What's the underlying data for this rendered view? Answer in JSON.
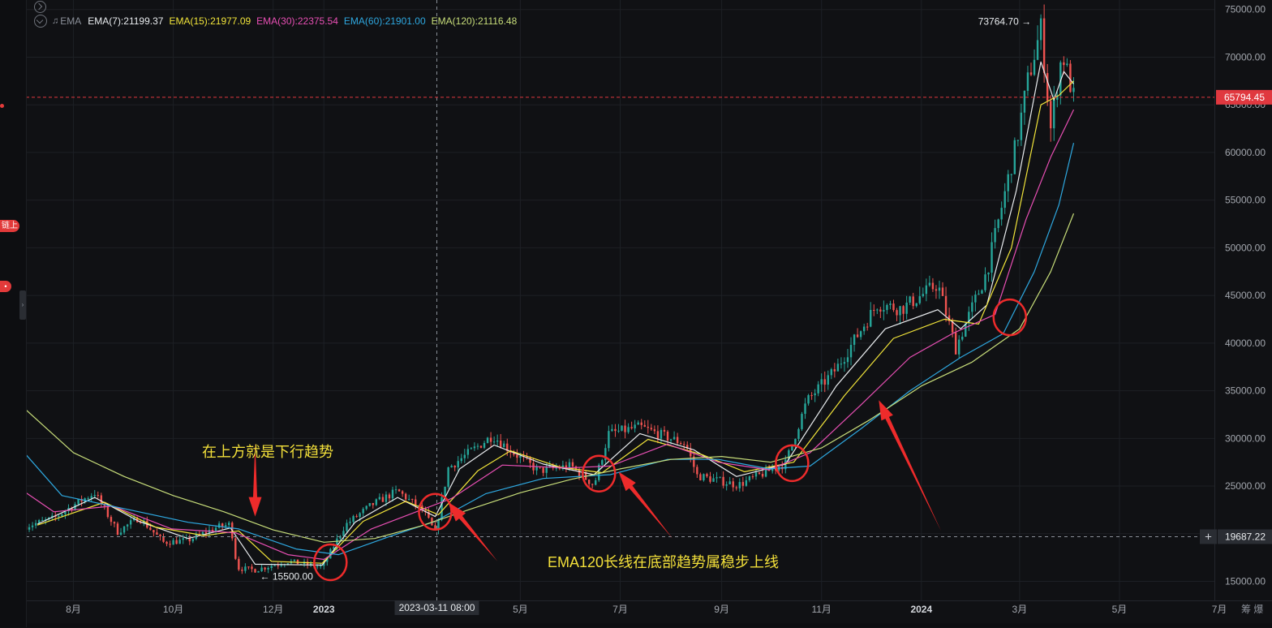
{
  "legend": {
    "indicator": "EMA",
    "items": [
      {
        "label": "EMA(7):21199.37",
        "color": "#e9ecef"
      },
      {
        "label": "EMA(15):21977.09",
        "color": "#f2e53a"
      },
      {
        "label": "EMA(30):22375.54",
        "color": "#e84fb4"
      },
      {
        "label": "EMA(60):21901.00",
        "color": "#2ea8e0"
      },
      {
        "label": "EMA(120):21116.48",
        "color": "#c8de7a"
      }
    ]
  },
  "left_rail": {
    "badge": "链上",
    "dot": "•"
  },
  "annotations": {
    "top_text": "在上方就是下行趋势",
    "bottom_text": "EMA120长线在底部趋势属稳步上线",
    "high_label": "73764.70",
    "low_label": "15500.00"
  },
  "markers": {
    "current_price": "65794.45",
    "crosshair_price": "19687.22",
    "crosshair_time": "2023-03-11 08:00"
  },
  "corner_label": "筹 爆",
  "colors": {
    "up": "#26a69a",
    "down": "#ef5350",
    "grid": "#1d2025",
    "annotation": "#f3e03a",
    "arrow": "#ee2b2b",
    "price_tag": "#e0383f"
  },
  "chart_data": {
    "type": "line",
    "title": "",
    "xlabel": "",
    "ylabel": "",
    "ylim": [
      13000,
      76000
    ],
    "y_ticks": [
      15000,
      20000,
      25000,
      30000,
      35000,
      40000,
      45000,
      50000,
      55000,
      60000,
      65000,
      70000,
      75000
    ],
    "y_tick_labels": [
      "15000.00",
      "20000.00",
      "25000.00",
      "30000.00",
      "35000.00",
      "40000.00",
      "45000.00",
      "50000.00",
      "55000.00",
      "60000.00",
      "65000.00",
      "70000.00",
      "75000.00"
    ],
    "xlim": [
      "2022-07-03",
      "2024-06-28"
    ],
    "x_ticks": [
      {
        "date": "2022-08-01",
        "label": "8月"
      },
      {
        "date": "2022-10-01",
        "label": "10月"
      },
      {
        "date": "2022-12-01",
        "label": "12月"
      },
      {
        "date": "2023-01-01",
        "label": "2023"
      },
      {
        "date": "2023-05-01",
        "label": "5月"
      },
      {
        "date": "2023-07-01",
        "label": "7月"
      },
      {
        "date": "2023-09-01",
        "label": "9月"
      },
      {
        "date": "2023-11-01",
        "label": "11月"
      },
      {
        "date": "2024-01-01",
        "label": "2024"
      },
      {
        "date": "2024-03-01",
        "label": "3月"
      },
      {
        "date": "2024-05-01",
        "label": "5月"
      },
      {
        "date": "2024-07-01",
        "label": "7月"
      }
    ],
    "price_path": [
      [
        "2022-07-03",
        20800
      ],
      [
        "2022-07-20",
        21600
      ],
      [
        "2022-08-01",
        23000
      ],
      [
        "2022-08-14",
        24300
      ],
      [
        "2022-08-28",
        20200
      ],
      [
        "2022-09-10",
        21700
      ],
      [
        "2022-09-25",
        19100
      ],
      [
        "2022-10-10",
        19300
      ],
      [
        "2022-10-28",
        20700
      ],
      [
        "2022-11-05",
        21000
      ],
      [
        "2022-11-09",
        16400
      ],
      [
        "2022-11-20",
        16200
      ],
      [
        "2022-12-10",
        17100
      ],
      [
        "2022-12-31",
        16500
      ],
      [
        "2023-01-14",
        20900
      ],
      [
        "2023-01-30",
        23000
      ],
      [
        "2023-02-15",
        24500
      ],
      [
        "2023-03-03",
        22300
      ],
      [
        "2023-03-10",
        20100
      ],
      [
        "2023-03-18",
        26900
      ],
      [
        "2023-04-14",
        30300
      ],
      [
        "2023-04-26",
        28600
      ],
      [
        "2023-05-12",
        26600
      ],
      [
        "2023-06-01",
        27100
      ],
      [
        "2023-06-15",
        25100
      ],
      [
        "2023-06-24",
        30500
      ],
      [
        "2023-07-13",
        31200
      ],
      [
        "2023-08-10",
        29400
      ],
      [
        "2023-08-17",
        26100
      ],
      [
        "2023-09-11",
        25100
      ],
      [
        "2023-10-10",
        27400
      ],
      [
        "2023-10-23",
        33900
      ],
      [
        "2023-11-10",
        37300
      ],
      [
        "2023-12-05",
        44100
      ],
      [
        "2023-12-20",
        43600
      ],
      [
        "2024-01-11",
        46200
      ],
      [
        "2024-01-22",
        39500
      ],
      [
        "2024-02-10",
        47500
      ],
      [
        "2024-02-28",
        61000
      ],
      [
        "2024-03-06",
        67500
      ],
      [
        "2024-03-14",
        73000
      ],
      [
        "2024-03-20",
        62500
      ],
      [
        "2024-03-27",
        70500
      ],
      [
        "2024-04-03",
        65794
      ]
    ],
    "high": {
      "date": "2024-03-14",
      "value": 73764.7
    },
    "low": {
      "date": "2022-11-21",
      "value": 15500.0
    },
    "current_price": 65794.45,
    "crosshair": {
      "date": "2023-03-11",
      "value": 19687.22
    },
    "series": [
      {
        "name": "EMA(7)",
        "color": "#e9ecef",
        "points": [
          [
            "2022-07-10",
            21000
          ],
          [
            "2022-08-14",
            23800
          ],
          [
            "2022-09-10",
            21300
          ],
          [
            "2022-10-10",
            19500
          ],
          [
            "2022-11-05",
            20600
          ],
          [
            "2022-11-20",
            16800
          ],
          [
            "2022-12-31",
            16700
          ],
          [
            "2023-01-20",
            21200
          ],
          [
            "2023-02-15",
            23800
          ],
          [
            "2023-03-10",
            21800
          ],
          [
            "2023-03-25",
            26800
          ],
          [
            "2023-04-15",
            29300
          ],
          [
            "2023-05-15",
            27300
          ],
          [
            "2023-06-15",
            26200
          ],
          [
            "2023-07-13",
            30500
          ],
          [
            "2023-08-15",
            28800
          ],
          [
            "2023-09-10",
            26000
          ],
          [
            "2023-10-10",
            27300
          ],
          [
            "2023-11-10",
            35500
          ],
          [
            "2023-12-10",
            41500
          ],
          [
            "2024-01-11",
            43500
          ],
          [
            "2024-01-25",
            41500
          ],
          [
            "2024-02-10",
            44000
          ],
          [
            "2024-02-28",
            56000
          ],
          [
            "2024-03-14",
            69500
          ],
          [
            "2024-03-22",
            65500
          ],
          [
            "2024-03-28",
            68500
          ],
          [
            "2024-04-03",
            67200
          ]
        ]
      },
      {
        "name": "EMA(15)",
        "color": "#f2e53a",
        "points": [
          [
            "2022-07-10",
            20900
          ],
          [
            "2022-08-20",
            23300
          ],
          [
            "2022-09-20",
            20700
          ],
          [
            "2022-10-20",
            19800
          ],
          [
            "2022-11-10",
            20300
          ],
          [
            "2022-11-30",
            17100
          ],
          [
            "2022-12-31",
            16900
          ],
          [
            "2023-01-25",
            21300
          ],
          [
            "2023-02-20",
            23400
          ],
          [
            "2023-03-12",
            22000
          ],
          [
            "2023-04-05",
            26600
          ],
          [
            "2023-04-25",
            28700
          ],
          [
            "2023-05-25",
            27000
          ],
          [
            "2023-06-20",
            26400
          ],
          [
            "2023-07-18",
            29900
          ],
          [
            "2023-08-20",
            28300
          ],
          [
            "2023-09-15",
            26500
          ],
          [
            "2023-10-15",
            27500
          ],
          [
            "2023-11-15",
            34500
          ],
          [
            "2023-12-15",
            40500
          ],
          [
            "2024-01-15",
            42500
          ],
          [
            "2024-02-05",
            42000
          ],
          [
            "2024-02-25",
            50000
          ],
          [
            "2024-03-14",
            65000
          ],
          [
            "2024-03-25",
            66000
          ],
          [
            "2024-04-03",
            67500
          ]
        ]
      },
      {
        "name": "EMA(30)",
        "color": "#e84fb4",
        "points": [
          [
            "2022-07-03",
            24300
          ],
          [
            "2022-07-20",
            22300
          ],
          [
            "2022-08-25",
            22900
          ],
          [
            "2022-09-30",
            20500
          ],
          [
            "2022-11-08",
            20100
          ],
          [
            "2022-12-10",
            17800
          ],
          [
            "2023-01-01",
            17300
          ],
          [
            "2023-01-30",
            20500
          ],
          [
            "2023-02-28",
            22400
          ],
          [
            "2023-03-20",
            23700
          ],
          [
            "2023-04-20",
            27200
          ],
          [
            "2023-05-30",
            26900
          ],
          [
            "2023-06-25",
            27100
          ],
          [
            "2023-07-30",
            29400
          ],
          [
            "2023-08-30",
            27500
          ],
          [
            "2023-09-30",
            26700
          ],
          [
            "2023-10-25",
            28500
          ],
          [
            "2023-11-25",
            33500
          ],
          [
            "2023-12-25",
            38500
          ],
          [
            "2024-01-20",
            41000
          ],
          [
            "2024-02-15",
            43000
          ],
          [
            "2024-03-05",
            53000
          ],
          [
            "2024-03-20",
            59500
          ],
          [
            "2024-04-03",
            64500
          ]
        ]
      },
      {
        "name": "EMA(60)",
        "color": "#2ea8e0",
        "points": [
          [
            "2022-07-03",
            28300
          ],
          [
            "2022-07-25",
            24000
          ],
          [
            "2022-08-30",
            22700
          ],
          [
            "2022-10-10",
            21200
          ],
          [
            "2022-11-10",
            20500
          ],
          [
            "2022-12-15",
            18400
          ],
          [
            "2023-01-10",
            17800
          ],
          [
            "2023-02-10",
            19700
          ],
          [
            "2023-03-10",
            21300
          ],
          [
            "2023-04-10",
            24200
          ],
          [
            "2023-05-15",
            25800
          ],
          [
            "2023-06-25",
            26200
          ],
          [
            "2023-07-30",
            27800
          ],
          [
            "2023-08-30",
            27800
          ],
          [
            "2023-09-30",
            26800
          ],
          [
            "2023-10-25",
            27100
          ],
          [
            "2023-11-25",
            31000
          ],
          [
            "2023-12-25",
            35000
          ],
          [
            "2024-01-25",
            38500
          ],
          [
            "2024-02-20",
            41000
          ],
          [
            "2024-03-10",
            47500
          ],
          [
            "2024-03-25",
            54500
          ],
          [
            "2024-04-03",
            61000
          ]
        ]
      },
      {
        "name": "EMA(120)",
        "color": "#c8de7a",
        "points": [
          [
            "2022-07-03",
            33000
          ],
          [
            "2022-08-01",
            28500
          ],
          [
            "2022-09-01",
            26000
          ],
          [
            "2022-10-01",
            24000
          ],
          [
            "2022-11-01",
            22300
          ],
          [
            "2022-12-01",
            20400
          ],
          [
            "2023-01-01",
            19100
          ],
          [
            "2023-02-01",
            19500
          ],
          [
            "2023-03-01",
            20800
          ],
          [
            "2023-04-01",
            22600
          ],
          [
            "2023-05-01",
            24300
          ],
          [
            "2023-06-01",
            25700
          ],
          [
            "2023-07-01",
            26800
          ],
          [
            "2023-08-01",
            27800
          ],
          [
            "2023-09-01",
            28100
          ],
          [
            "2023-10-01",
            27500
          ],
          [
            "2023-11-01",
            29000
          ],
          [
            "2023-12-01",
            32000
          ],
          [
            "2024-01-01",
            35500
          ],
          [
            "2024-02-01",
            38000
          ],
          [
            "2024-03-01",
            41500
          ],
          [
            "2024-03-20",
            47500
          ],
          [
            "2024-04-03",
            53600
          ]
        ]
      }
    ],
    "highlight_circles": [
      {
        "date": "2023-01-05",
        "value": 17000
      },
      {
        "date": "2023-03-10",
        "value": 22300
      },
      {
        "date": "2023-06-18",
        "value": 26300
      },
      {
        "date": "2023-10-14",
        "value": 27400
      },
      {
        "date": "2024-02-24",
        "value": 42700
      }
    ],
    "arrows": [
      {
        "from": [
          "2022-11-20",
          29500
        ],
        "to": [
          "2022-11-20",
          21800
        ]
      },
      {
        "from": [
          "2023-04-17",
          17100
        ],
        "to": [
          "2023-03-18",
          23300
        ]
      },
      {
        "from": [
          "2023-08-02",
          19500
        ],
        "to": [
          "2023-06-30",
          26500
        ]
      },
      {
        "from": [
          "2024-01-13",
          20300
        ],
        "to": [
          "2023-12-06",
          34000
        ]
      }
    ]
  }
}
